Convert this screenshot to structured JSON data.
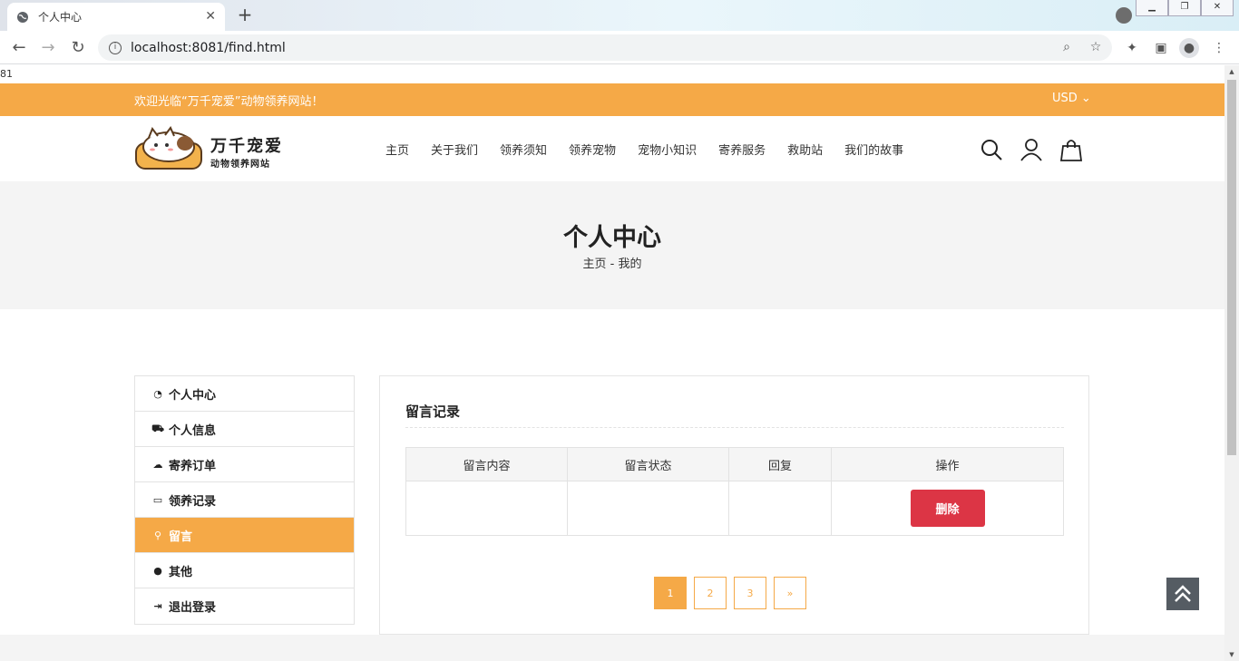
{
  "browser": {
    "tab_title": "个人中心",
    "tab_close": "✕",
    "new_tab": "+",
    "url": "localhost:8081/find.html"
  },
  "page": {
    "stray_text": "81",
    "welcome": "欢迎光临“万千宠爱”动物领养网站！",
    "currency": "USD ⌄",
    "logo_big": "万千宠爱",
    "logo_small": "动物领养网站",
    "nav": [
      "主页",
      "关于我们",
      "领养须知",
      "领养宠物",
      "宠物小知识",
      "寄养服务",
      "救助站",
      "我们的故事"
    ],
    "banner_title": "个人中心",
    "breadcrumb": "主页 - 我的",
    "accent_color": "#f5a947",
    "danger_color": "#dc3545"
  },
  "sidebar": {
    "items": [
      {
        "label": "个人中心",
        "icon": "dashboard-icon",
        "active": false
      },
      {
        "label": "个人信息",
        "icon": "cart-icon",
        "active": false
      },
      {
        "label": "寄养订单",
        "icon": "cloud-download-icon",
        "active": false
      },
      {
        "label": "领养记录",
        "icon": "credit-card-icon",
        "active": false
      },
      {
        "label": "留言",
        "icon": "map-marker-icon",
        "active": true
      },
      {
        "label": "其他",
        "icon": "user-icon",
        "active": false
      },
      {
        "label": "退出登录",
        "icon": "sign-out-icon",
        "active": false
      }
    ]
  },
  "panel": {
    "title": "留言记录",
    "columns": [
      "留言内容",
      "留言状态",
      "回复",
      "操作"
    ],
    "rows": [
      {
        "content": "",
        "status": "",
        "reply": "",
        "action": "删除"
      }
    ],
    "pagination": [
      "1",
      "2",
      "3",
      "»"
    ],
    "current_page": "1"
  }
}
